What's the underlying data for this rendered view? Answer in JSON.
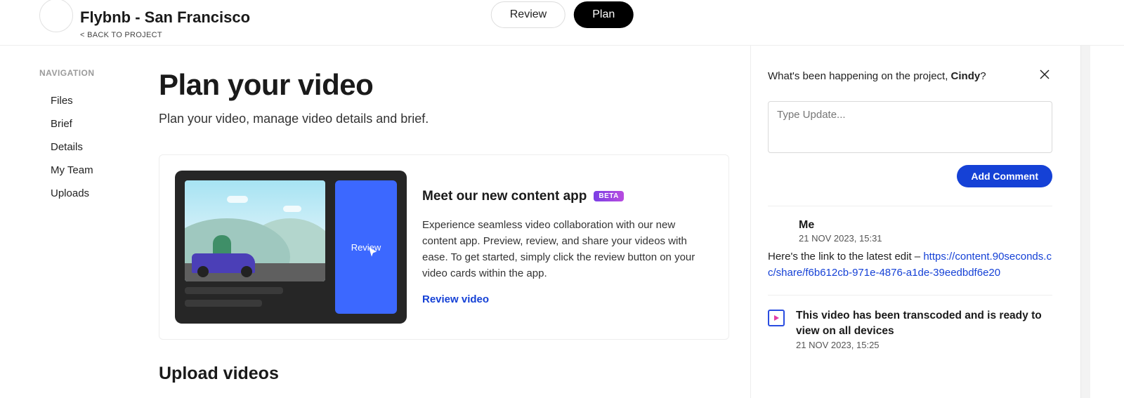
{
  "header": {
    "project_title": "Flybnb - San Francisco",
    "back_label": "< BACK TO PROJECT",
    "tabs": {
      "review": "Review",
      "plan": "Plan"
    }
  },
  "nav": {
    "label": "NAVIGATION",
    "items": [
      "Files",
      "Brief",
      "Details",
      "My Team",
      "Uploads"
    ]
  },
  "main": {
    "title": "Plan your video",
    "subtitle": "Plan your video, manage video details and brief.",
    "promo": {
      "heading": "Meet our new content app",
      "badge": "BETA",
      "body": "Experience seamless video collaboration with our new content app. Preview, review, and share your videos with ease. To get started, simply click the review button on your video cards within the app.",
      "review_link": "Review video",
      "panel_label": "Review"
    },
    "upload_heading": "Upload videos"
  },
  "activity": {
    "prompt_prefix": "What's been happening on the project, ",
    "prompt_name": "Cindy",
    "prompt_suffix": "?",
    "input_placeholder": "Type Update...",
    "add_comment": "Add Comment",
    "items": [
      {
        "author": "Me",
        "time": "21 NOV 2023, 15:31",
        "body_prefix": "Here's the link to the latest edit – ",
        "body_link": "https://content.90seconds.cc/share/f6b612cb-971e-4876-a1de-39eedbdf6e20"
      },
      {
        "title": "This video has been transcoded and is ready to view on all devices",
        "time": "21 NOV 2023, 15:25"
      }
    ]
  }
}
